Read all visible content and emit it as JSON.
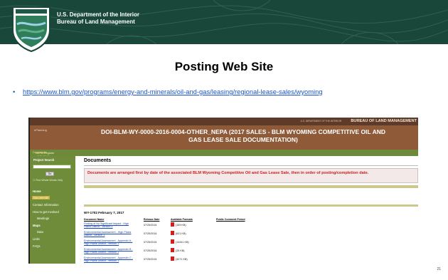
{
  "slide": {
    "header_line1": "U.S. Department of the Interior",
    "header_line2": "Bureau of Land Management",
    "title": "Posting Web Site",
    "url": "https://www.blm.gov/programs/energy-and-minerals/oil-and-gas/leasing/regional-lease-sales/wyoming",
    "page_number": "21",
    "colors": {
      "banner": "#19473a",
      "link": "#1a55c8"
    }
  },
  "site": {
    "doi_text": "U.S. DEPARTMENT OF THE INTERIOR",
    "blm_text": "BUREAU OF LAND MANAGEMENT",
    "home_label": "ePlanning",
    "page_heading_line1": "DOI-BLM-WY-0000-2016-0004-OTHER_NEPA (2017 SALES - BLM WYOMING COMPETITIVE OIL AND",
    "page_heading_line2": "GAS LEASE SALE DOCUMENTATION)",
    "breadcrumb": "NEPA Register › DOI-BLM-WY-0000-2016-0004-OTHER_NEPA ›",
    "breadcrumb_current": "Documents",
    "sidebar": {
      "search_heading": "Project Search",
      "go_label": "Go",
      "whole_words_label": "Find Whole Words Only",
      "items": [
        "Home",
        "Documents",
        "Contact Information",
        "How to get Involved",
        "Meetings",
        "Maps",
        "Data",
        "Links",
        "FAQs"
      ]
    },
    "documents_title": "Documents",
    "notice": "Documents are arranged first by date of the associated BLM Wyoming Competitive Oil and Gas Lease Sale, then in order of posting/completion date.",
    "sale_heading": "WY-1702 February 7, 2017",
    "columns": [
      "Document Name",
      "Release Date",
      "Available Formats",
      "Public Comment Period"
    ],
    "rows": [
      {
        "name": "Finding of No Significant Impact - High Plains District - version 1",
        "date": "07/25/2016",
        "format": "(159 KB)"
      },
      {
        "name": "Environmental Assessment - High Plains District - version 1",
        "date": "07/25/2016",
        "format": "(621 KB)"
      },
      {
        "name": "Environmental Assessment - Appendix A - High Plains District - version 1",
        "date": "07/25/2016",
        "format": "(14441 KB)"
      },
      {
        "name": "Environmental Assessment - Appendix B - High Plains District - version 1",
        "date": "07/25/2016",
        "format": "(25 KB)"
      },
      {
        "name": "Environmental Assessment - Appendix C - High Plains District - version 1",
        "date": "07/25/2016",
        "format": "(4271 KB)"
      }
    ]
  }
}
